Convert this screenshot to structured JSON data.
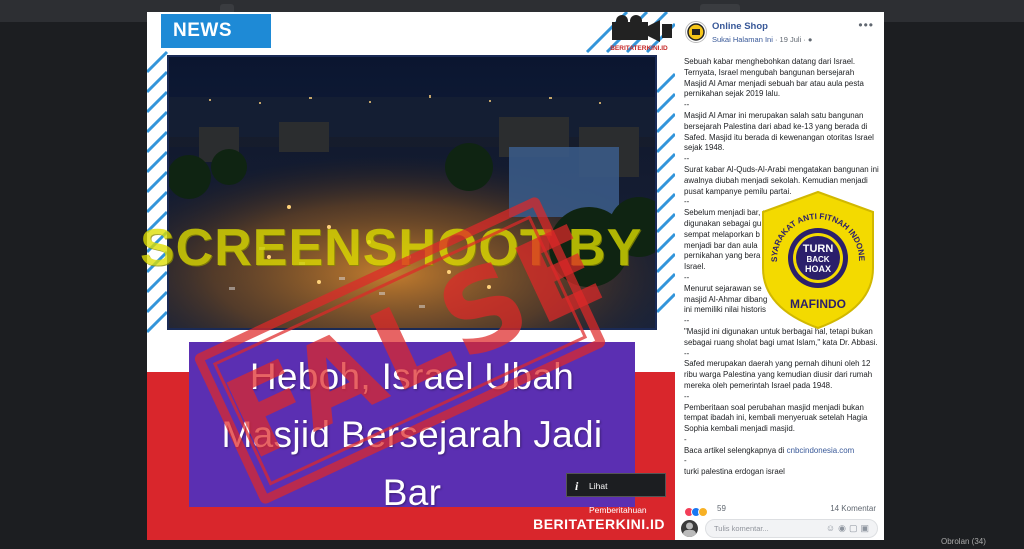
{
  "viewer": {
    "news_tag": "NEWS",
    "camera_logo_text": "BERITATERKINI.ID",
    "headline_lines": [
      "Heboh, Israel Ubah",
      "Masjid Bersejarah Jadi",
      "Bar"
    ],
    "site_mark": "BERITATERKINI.ID",
    "notice_button": "Lihat Pemberitahuan"
  },
  "overlay": {
    "watermark": "SCREENSHOOT BY",
    "stamp": "FALSE",
    "badge_top": "MASYARAKAT ANTI FITNAH INDONESIA",
    "badge_bottom": "MAFINDO",
    "badge_center": [
      "TURN",
      "BACK",
      "HOAX"
    ]
  },
  "post": {
    "page_name": "Online Shop",
    "meta_liked": "Sukai Halaman Ini",
    "meta_date": "· 19 Juli ·",
    "paragraphs": [
      "Sebuah kabar menghebohkan datang dari Israel. Ternyata, Israel mengubah bangunan bersejarah Masjid Al Amar menjadi sebuah bar atau aula pesta pernikahan sejak 2019 lalu.",
      "--",
      "Masjid Al Amar ini merupakan salah satu bangunan bersejarah Palestina dari abad ke-13 yang berada di Safed. Masjid itu berada di kewenangan otoritas Israel sejak 1948.",
      "--",
      "Surat kabar Al-Quds-Al-Arabi mengatakan bangunan ini awalnya diubah menjadi sekolah. Kemudian menjadi pusat kampanye pemilu partai.",
      "--",
      "Sebelum menjadi bar, masjid ini",
      "digunakan sebagai gu",
      "sempat melaporkan b",
      "menjadi bar dan aula",
      "pernikahan yang bera",
      "Israel.",
      "--",
      "Menurut sejarawan se",
      "masjid Al-Ahmar dibang",
      "ini memiliki nilai historis",
      "--",
      "\"Masjid ini digunakan untuk berbagai hal, tetapi bukan sebagai ruang sholat bagi umat Islam,\" kata Dr. Abbasi.",
      "--",
      "Safed merupakan daerah yang pernah dihuni oleh 12 ribu warga Palestina yang kemudian diusir dari rumah mereka oleh pemerintah Israel pada 1948.",
      "--",
      "Pemberitaan soal perubahan masjid menjadi bukan tempat ibadah ini, kembali menyeruak setelah Hagia Sophia kembali menjadi masjid.",
      "-"
    ],
    "read_more_prefix": "Baca artikel selengkapnya di ",
    "read_more_link": "cnbcindonesia.com",
    "dash_final": "-",
    "tags": "turki palestina erdogan israel",
    "reaction_count": "59",
    "comment_count": "14 Komentar",
    "comment_placeholder": "Tulis komentar..."
  },
  "footer": {
    "text": "Obrolan (34)"
  }
}
